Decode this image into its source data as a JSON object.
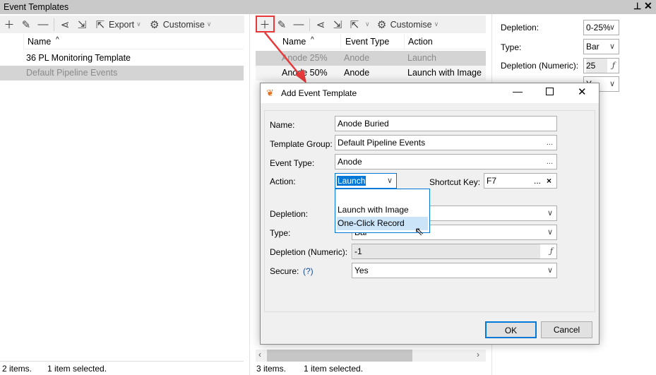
{
  "panel": {
    "title": "Event Templates",
    "pin_icon": "pin-icon",
    "close_icon": "close-icon"
  },
  "left": {
    "export": "Export",
    "customise": "Customise",
    "col_name": "Name",
    "rows": [
      "36 PL Monitoring Template",
      "Default Pipeline Events"
    ],
    "status_items": "2 items.",
    "status_selected": "1 item selected."
  },
  "middle": {
    "customise": "Customise",
    "cols": [
      "Name",
      "Event Type",
      "Action"
    ],
    "rows": [
      [
        "Anode 25%",
        "Anode",
        "Launch"
      ],
      [
        "Anode 50%",
        "Anode",
        "Launch with Image"
      ]
    ],
    "status_items": "3 items.",
    "status_selected": "1 item selected."
  },
  "right": {
    "depletion_label": "Depletion:",
    "depletion_value": "0-25%",
    "type_label": "Type:",
    "type_value": "Bar",
    "numeric_label": "Depletion (Numeric):",
    "numeric_value": "25",
    "secure_value": "Y"
  },
  "dialog": {
    "title": "Add Event Template",
    "name_label": "Name:",
    "name_value": "Anode Buried",
    "group_label": "Template Group:",
    "group_value": "Default Pipeline Events",
    "etype_label": "Event Type:",
    "etype_value": "Anode",
    "action_label": "Action:",
    "action_value": "Launch",
    "shortcut_label": "Shortcut Key:",
    "shortcut_value": "F7",
    "depletion_label": "Depletion:",
    "type_label": "Type:",
    "type_value": "Bar",
    "numeric_label": "Depletion (Numeric):",
    "numeric_value": "-1",
    "secure_label": "Secure:",
    "secure_help": "(?)",
    "secure_value": "Yes",
    "ellipsis": "...",
    "fx": "ƒ",
    "clear": "×",
    "ok": "OK",
    "cancel": "Cancel",
    "dropdown_options": [
      "",
      "Launch with Image",
      "One-Click Record"
    ],
    "dropdown_highlighted": "One-Click Record"
  },
  "colors": {
    "highlight_box": "#e8393a",
    "accent": "#0078d7",
    "selected_row": "#d4d4d4"
  }
}
